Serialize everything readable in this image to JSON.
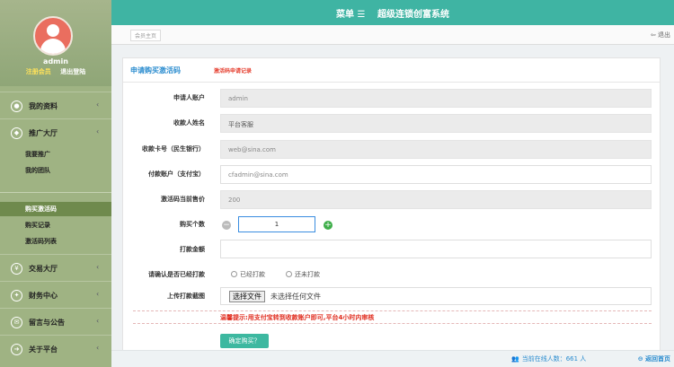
{
  "sidebar": {
    "username": "admin",
    "register_label": "注册会员",
    "logout_label": "退出登陆",
    "menus": [
      {
        "label": "我的资料",
        "icon": "user-icon"
      },
      {
        "label": "推广大厅",
        "icon": "share-icon"
      },
      {
        "label": "交易大厅",
        "icon": "yen-icon"
      },
      {
        "label": "财务中心",
        "icon": "finance-icon"
      },
      {
        "label": "留言与公告",
        "icon": "message-icon"
      },
      {
        "label": "关于平台",
        "icon": "arrow-icon"
      }
    ],
    "promo_sub": [
      "我要推广",
      "我的团队"
    ],
    "code_sub": [
      "购买激活码",
      "购买记录",
      "激活码列表"
    ]
  },
  "header": {
    "menu_label": "菜单 ☰",
    "title": "超级连锁创富系统"
  },
  "tabbar": {
    "tab_label": "会员主页",
    "exit_label": "退出"
  },
  "panel": {
    "title": "申请购买激活码",
    "record_link": "激活码申请记录"
  },
  "form": {
    "applicant_label": "申请人账户",
    "applicant_value": "admin",
    "payee_name_label": "收款人姓名",
    "payee_name_value": "平台客服",
    "card_label": "收款卡号（民生银行）",
    "card_value": "web@sina.com",
    "pay_account_label": "付款账户（支付宝）",
    "pay_account_value": "cfadmin@sina.com",
    "price_label": "激活码当前售价",
    "price_value": "200",
    "qty_label": "购买个数",
    "qty_value": "1",
    "amount_label": "打款金额",
    "confirm_label": "请确认是否已经打款",
    "radio_paid": "已经打款",
    "radio_unpaid": "还未打款",
    "upload_label": "上传打款截图",
    "file_button": "选择文件",
    "file_name": "未选择任何文件",
    "warning": "温馨提示:用支付宝转到收款账户即可,平台4小时内审核",
    "submit_label": "确定购买？"
  },
  "footer": {
    "online_text": "当前在线人数：661 人",
    "home_label": "返回首页"
  }
}
